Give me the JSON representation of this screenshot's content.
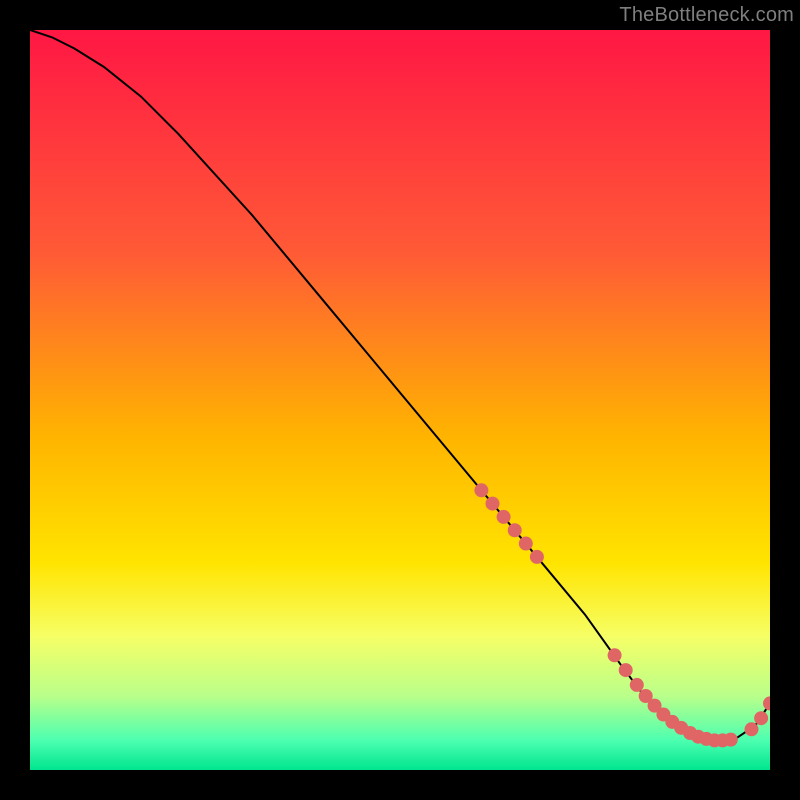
{
  "attribution": "TheBottleneck.com",
  "chart_data": {
    "type": "line",
    "title": "",
    "xlabel": "",
    "ylabel": "",
    "xlim": [
      0,
      100
    ],
    "ylim": [
      0,
      100
    ],
    "grid": false,
    "legend": false,
    "background_gradient": {
      "stops": [
        {
          "offset": 0.0,
          "color": "#ff1744"
        },
        {
          "offset": 0.3,
          "color": "#ff5a36"
        },
        {
          "offset": 0.55,
          "color": "#ffb400"
        },
        {
          "offset": 0.72,
          "color": "#ffe400"
        },
        {
          "offset": 0.82,
          "color": "#f6ff66"
        },
        {
          "offset": 0.9,
          "color": "#b9ff8a"
        },
        {
          "offset": 0.96,
          "color": "#4cffb0"
        },
        {
          "offset": 1.0,
          "color": "#00e58f"
        }
      ]
    },
    "series": [
      {
        "name": "curve",
        "color": "#000000",
        "x": [
          0,
          3,
          6,
          10,
          15,
          20,
          30,
          40,
          50,
          60,
          65,
          70,
          75,
          80,
          83,
          86,
          89,
          92,
          95,
          98,
          100
        ],
        "y": [
          100,
          99,
          97.5,
          95,
          91,
          86,
          75,
          63,
          51,
          39,
          33,
          27,
          21,
          14,
          10,
          7,
          5,
          4,
          4,
          6,
          9
        ]
      }
    ],
    "scatter": [
      {
        "name": "dots",
        "color": "#e06666",
        "marker_size": 7,
        "points": [
          {
            "x": 61,
            "y": 37.8
          },
          {
            "x": 62.5,
            "y": 36
          },
          {
            "x": 64,
            "y": 34.2
          },
          {
            "x": 65.5,
            "y": 32.4
          },
          {
            "x": 67,
            "y": 30.6
          },
          {
            "x": 68.5,
            "y": 28.8
          },
          {
            "x": 79,
            "y": 15.5
          },
          {
            "x": 80.5,
            "y": 13.5
          },
          {
            "x": 82,
            "y": 11.5
          },
          {
            "x": 83.2,
            "y": 10
          },
          {
            "x": 84.4,
            "y": 8.7
          },
          {
            "x": 85.6,
            "y": 7.5
          },
          {
            "x": 86.8,
            "y": 6.5
          },
          {
            "x": 88,
            "y": 5.7
          },
          {
            "x": 89.2,
            "y": 5
          },
          {
            "x": 90.3,
            "y": 4.5
          },
          {
            "x": 91.4,
            "y": 4.2
          },
          {
            "x": 92.5,
            "y": 4
          },
          {
            "x": 93.6,
            "y": 4
          },
          {
            "x": 94.7,
            "y": 4.1
          },
          {
            "x": 97.5,
            "y": 5.5
          },
          {
            "x": 98.8,
            "y": 7
          },
          {
            "x": 100,
            "y": 9
          }
        ]
      }
    ]
  }
}
